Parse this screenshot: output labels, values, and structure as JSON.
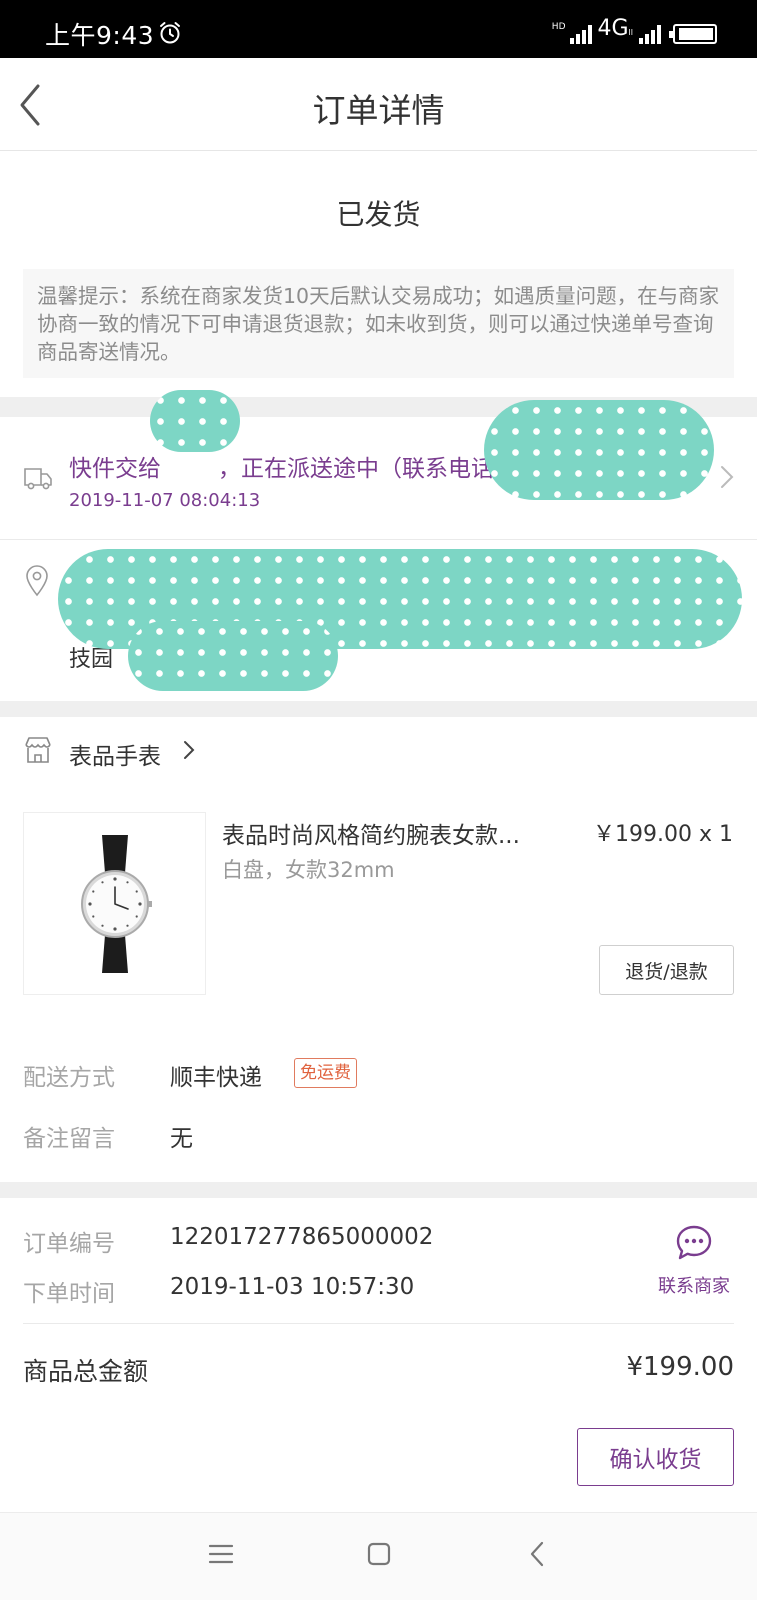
{
  "status_bar": {
    "time": "上午9:43",
    "alarm_icon": "alarm-clock-icon",
    "hd_label": "HD",
    "network": "4G",
    "network_sub": "ll"
  },
  "nav": {
    "title": "订单详情",
    "back_icon": "chevron-left-icon"
  },
  "order_status": "已发货",
  "tip": "温馨提示：系统在商家发货10天后默认交易成功；如遇质量问题，在与商家协商一致的情况下可申请退货退款；如未收到货，则可以通过快递单号查询商品寄送情况。",
  "logistics": {
    "text": "快件交给",
    "text_tail": "，正在派送途中（联系电话",
    "time": "2019-11-07 08:04:13",
    "icon": "truck-icon"
  },
  "address": {
    "icon": "location-pin-icon",
    "visible_text": "技园"
  },
  "shop": {
    "name": "表品手表",
    "icon": "store-icon"
  },
  "product": {
    "name": "表品时尚风格简约腕表女款...",
    "spec": "白盘，女款32mm",
    "price": "￥199.00",
    "quantity": "x 1",
    "refund_label": "退货/退款"
  },
  "delivery": {
    "label": "配送方式",
    "value": "顺丰快递",
    "badge": "免运费"
  },
  "remark": {
    "label": "备注留言",
    "value": "无"
  },
  "order_info": {
    "number_label": "订单编号",
    "number_value": "122017277865000002",
    "time_label": "下单时间",
    "time_value": "2019-11-03 10:57:30"
  },
  "contact": {
    "label": "联系商家",
    "icon": "chat-bubble-icon"
  },
  "total": {
    "label": "商品总金额",
    "value": "¥199.00"
  },
  "confirm_label": "确认收货",
  "colors": {
    "accent": "#7a3d8f",
    "badge": "#e0633f",
    "muted": "#a6a6a6",
    "mask": "#7dd6c5"
  }
}
